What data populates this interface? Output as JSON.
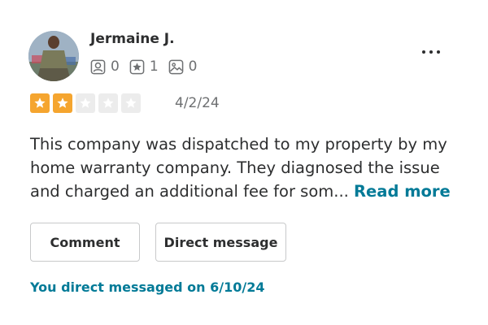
{
  "review": {
    "author": {
      "name": "Jermaine J.",
      "stats": {
        "friends": "0",
        "reviews": "1",
        "photos": "0"
      }
    },
    "rating": 2,
    "rating_max": 5,
    "date": "4/2/24",
    "text": "This company was dispatched to my property by my home warranty company.  They diagnosed the issue and charged an additional fee for som...",
    "read_more_label": "Read more"
  },
  "actions": {
    "comment_label": "Comment",
    "direct_message_label": "Direct message"
  },
  "dm_status": "You direct messaged on 6/10/24",
  "colors": {
    "star_on": "#f5a52f",
    "star_off": "#ececec",
    "link": "#027a97"
  },
  "icons": {
    "friends": "friends-icon",
    "reviews": "review-star-icon",
    "photos": "photo-icon",
    "more": "more-options-icon"
  }
}
